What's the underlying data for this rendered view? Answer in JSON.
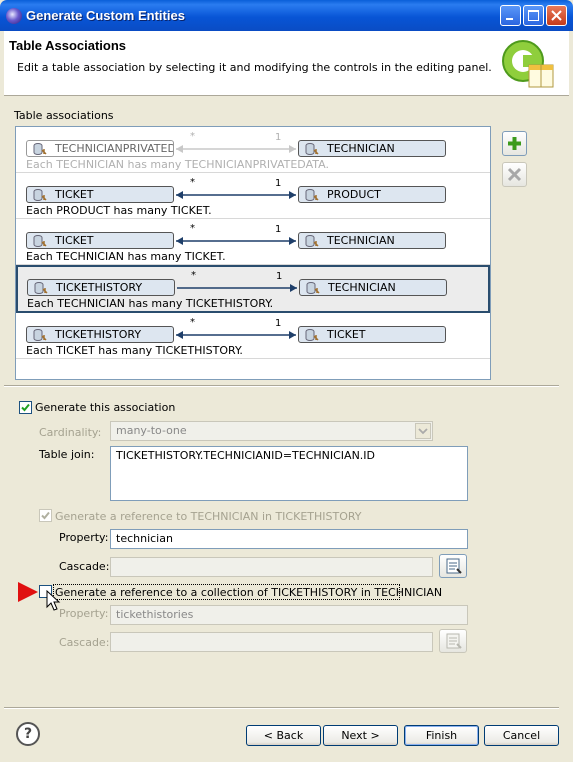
{
  "window": {
    "title": "Generate Custom Entities"
  },
  "header": {
    "title": "Table Associations",
    "description": "Edit a table association by selecting it and modifying the controls in the editing panel."
  },
  "list_label": "Table associations",
  "associations": [
    {
      "left": "TECHNICIANPRIVATEDA",
      "right": "TECHNICIAN",
      "left_card": "*",
      "right_card": "1",
      "desc": "Each TECHNICIAN has many TECHNICIANPRIVATEDATA.",
      "faded": true
    },
    {
      "left": "TICKET",
      "right": "PRODUCT",
      "left_card": "*",
      "right_card": "1",
      "desc": "Each PRODUCT has many TICKET."
    },
    {
      "left": "TICKET",
      "right": "TECHNICIAN",
      "left_card": "*",
      "right_card": "1",
      "desc": "Each TECHNICIAN has many TICKET."
    },
    {
      "left": "TICKETHISTORY",
      "right": "TECHNICIAN",
      "left_card": "*",
      "right_card": "1",
      "desc": "Each TECHNICIAN has many TICKETHISTORY.",
      "selected": true
    },
    {
      "left": "TICKETHISTORY",
      "right": "TICKET",
      "left_card": "*",
      "right_card": "1",
      "desc": "Each TICKET has many TICKETHISTORY."
    }
  ],
  "side_buttons": {
    "add_icon": "plus-icon",
    "remove_icon": "x-icon"
  },
  "editor": {
    "generate_label": "Generate this association",
    "cardinality_label": "Cardinality:",
    "cardinality_value": "many-to-one",
    "table_join_label": "Table join:",
    "table_join_value": "TICKETHISTORY.TECHNICIANID=TECHNICIAN.ID",
    "ref_label": "Generate a reference to TECHNICIAN in TICKETHISTORY",
    "property_label": "Property:",
    "property_value": "technician",
    "cascade_label": "Cascade:",
    "cascade_value": "",
    "coll_label": "Generate a reference to a collection of TICKETHISTORY in TECHNICIAN",
    "coll_property_label": "Property:",
    "coll_property_value": "tickethistories",
    "coll_cascade_label": "Cascade:",
    "coll_cascade_value": ""
  },
  "footer": {
    "help": "?",
    "back": "< Back",
    "next": "Next >",
    "finish": "Finish",
    "cancel": "Cancel"
  },
  "colors": {
    "titlebar": "#0a5fd8",
    "selection_border": "#2a4d6e",
    "red_arrow": "#e01010"
  }
}
